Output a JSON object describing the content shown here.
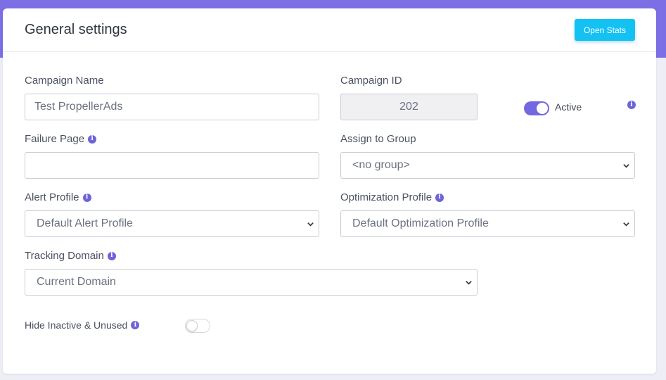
{
  "header": {
    "title": "General settings",
    "open_stats_label": "Open Stats"
  },
  "form": {
    "campaign_name": {
      "label": "Campaign Name",
      "value": "Test PropellerAds"
    },
    "campaign_id": {
      "label": "Campaign ID",
      "value": "202"
    },
    "active": {
      "label": "Active",
      "checked": true
    },
    "failure_page": {
      "label": "Failure Page",
      "value": ""
    },
    "assign_group": {
      "label": "Assign to Group",
      "value": "<no group>"
    },
    "alert_profile": {
      "label": "Alert Profile",
      "value": "Default Alert Profile"
    },
    "optimization_profile": {
      "label": "Optimization Profile",
      "value": "Default Optimization Profile"
    },
    "tracking_domain": {
      "label": "Tracking Domain",
      "value": "Current Domain"
    },
    "hide_inactive": {
      "label": "Hide Inactive & Unused",
      "checked": false
    }
  },
  "icons": {
    "info": "info-icon",
    "caret": "chevron-down-icon"
  },
  "colors": {
    "accent": "#7c6fe6",
    "button": "#14c1f3",
    "info": "#6f63d9"
  }
}
